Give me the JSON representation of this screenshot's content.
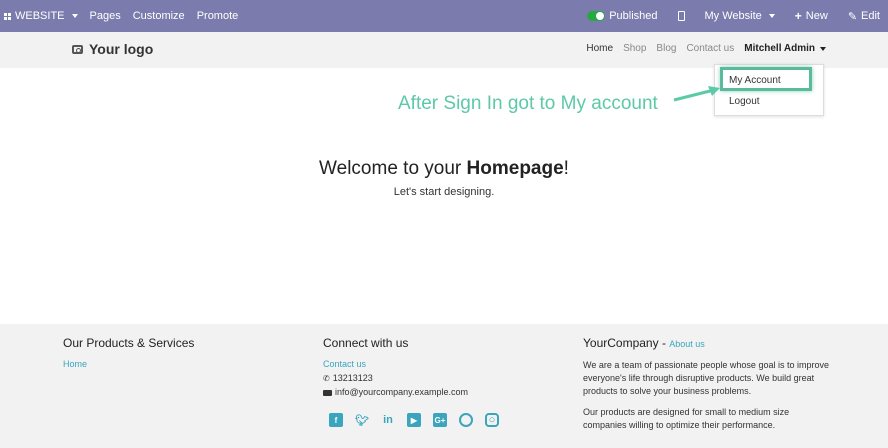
{
  "adminbar": {
    "brand": "WEBSITE",
    "menu": [
      "Pages",
      "Customize",
      "Promote"
    ],
    "published": "Published",
    "my_website": "My Website",
    "new": "New",
    "edit": "Edit"
  },
  "header": {
    "logo": "Your logo",
    "nav": [
      "Home",
      "Shop",
      "Blog",
      "Contact us"
    ],
    "user": "Mitchell Admin"
  },
  "dropdown": {
    "my_account": "My Account",
    "logout": "Logout"
  },
  "annotation": "After Sign In got to My account",
  "main": {
    "welcome_prefix": "Welcome to your ",
    "welcome_bold": "Homepage",
    "welcome_suffix": "!",
    "subtitle": "Let's start designing."
  },
  "footer": {
    "col1": {
      "title": "Our Products & Services",
      "link": "Home"
    },
    "col2": {
      "title": "Connect with us",
      "contact": "Contact us",
      "phone": "13213123",
      "email": "info@yourcompany.example.com"
    },
    "col3": {
      "title": "YourCompany",
      "dash": " - ",
      "about": "About us",
      "para1": "We are a team of passionate people whose goal is to improve everyone's life through disruptive products. We build great products to solve your business problems.",
      "para2": "Our products are designed for small to medium size companies willing to optimize their performance."
    }
  },
  "colors": {
    "adminbar": "#7c7bad",
    "accent": "#3aa5bd",
    "annotation": "#5cc9a7"
  }
}
